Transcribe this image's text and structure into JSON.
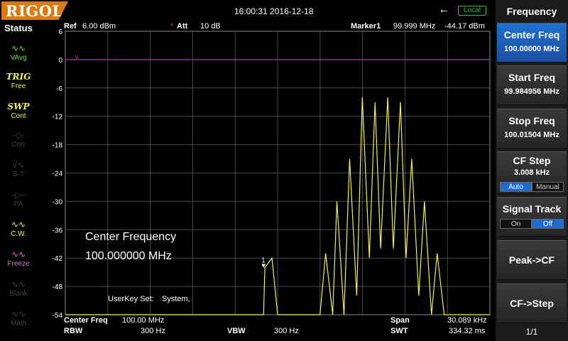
{
  "brand": {
    "logo_text": "RIGOL"
  },
  "topbar": {
    "datetime": "16:00:31 2016-12-18",
    "usb_icon": "usb-icon",
    "remote_status": "Local"
  },
  "status_panel": {
    "title": "Status",
    "items": [
      {
        "code": "AvgIcon",
        "label": "VAvg",
        "active": true
      },
      {
        "code": "TRIG",
        "label": "Free",
        "active": true
      },
      {
        "code": "SWP",
        "label": "Cont",
        "active": true
      },
      {
        "code": "~",
        "label": "Corr",
        "active": false
      },
      {
        "code": "ST",
        "label": "S-T",
        "active": false
      },
      {
        "code": "PA",
        "label": "PA",
        "active": false
      },
      {
        "code": "CW",
        "label": "C.W.",
        "active": true
      },
      {
        "code": "Frz",
        "label": "Freeze",
        "active": true
      },
      {
        "code": "Blank",
        "label": "Blank",
        "active": false
      },
      {
        "code": "Math",
        "label": "Math",
        "active": false
      }
    ]
  },
  "measurement": {
    "ref_label": "Ref",
    "ref_value": "6.00 dBm",
    "att_marker": "*",
    "att_label": "Att",
    "att_value": "10 dB",
    "marker_label": "Marker1",
    "marker_freq": "99.999 MHz",
    "marker_level": "-44.17 dBm",
    "marker_number": "1",
    "ref_marker_glyph": "v"
  },
  "chart_data": {
    "type": "line",
    "y_ticks": [
      "6",
      "0",
      "-6",
      "-12",
      "-18",
      "-24",
      "-30",
      "-36",
      "-42",
      "-48",
      "-54"
    ],
    "ylim": [
      -54,
      6
    ],
    "grid": true,
    "xlim_mhz": [
      99.984956,
      100.01504
    ],
    "x_divisions": 10,
    "marker1": {
      "x_mhz": 99.999,
      "y_dbm": -44.17
    },
    "reference_line_dbm": 0,
    "series": [
      {
        "color": "#f2f24a",
        "points": [
          [
            99.984956,
            -54
          ],
          [
            99.999,
            -54
          ],
          [
            99.9991,
            -44
          ],
          [
            99.9996,
            -42
          ],
          [
            100.0,
            -54
          ],
          [
            100.003,
            -54
          ],
          [
            100.0034,
            -41
          ],
          [
            100.0039,
            -54
          ],
          [
            100.0042,
            -30
          ],
          [
            100.0047,
            -54
          ],
          [
            100.0051,
            -21
          ],
          [
            100.0056,
            -50
          ],
          [
            100.006,
            -8
          ],
          [
            100.0065,
            -42
          ],
          [
            100.0069,
            -9
          ],
          [
            100.0073,
            -40
          ],
          [
            100.0078,
            -8
          ],
          [
            100.0082,
            -40
          ],
          [
            100.0087,
            -9
          ],
          [
            100.0091,
            -42
          ],
          [
            100.0095,
            -21
          ],
          [
            100.01,
            -50
          ],
          [
            100.0104,
            -30
          ],
          [
            100.0109,
            -54
          ],
          [
            100.0113,
            -41
          ],
          [
            100.0118,
            -54
          ],
          [
            100.01504,
            -54
          ]
        ]
      }
    ]
  },
  "overlay": {
    "title": "Center Frequency",
    "value": "100.000000 MHz",
    "userkey_label": "UserKey Set:",
    "userkey_value": "System,"
  },
  "footer": {
    "center_freq_label": "Center Freq",
    "center_freq_value": "100.00 MHz",
    "rbw_label": "RBW",
    "rbw_value": "300 Hz",
    "vbw_label": "VBW",
    "vbw_value": "300 Hz",
    "span_label": "Span",
    "span_value": "30.089 kHz",
    "swt_label": "SWT",
    "swt_value": "334.32 ms"
  },
  "menu": {
    "title": "Frequency",
    "center_freq": {
      "label": "Center Freq",
      "value": "100.00000 MHz"
    },
    "start_freq": {
      "label": "Start Freq",
      "value": "99.984956 MHz"
    },
    "stop_freq": {
      "label": "Stop Freq",
      "value": "100.01504 MHz"
    },
    "cf_step": {
      "label": "CF Step",
      "value": "3.008 kHz",
      "auto": "Auto",
      "manual": "Manual"
    },
    "signal_track": {
      "label": "Signal Track",
      "on": "On",
      "off": "Off"
    },
    "peak_cf": "Peak->CF",
    "cf_step_btn": "CF->Step",
    "page": "1/1"
  }
}
